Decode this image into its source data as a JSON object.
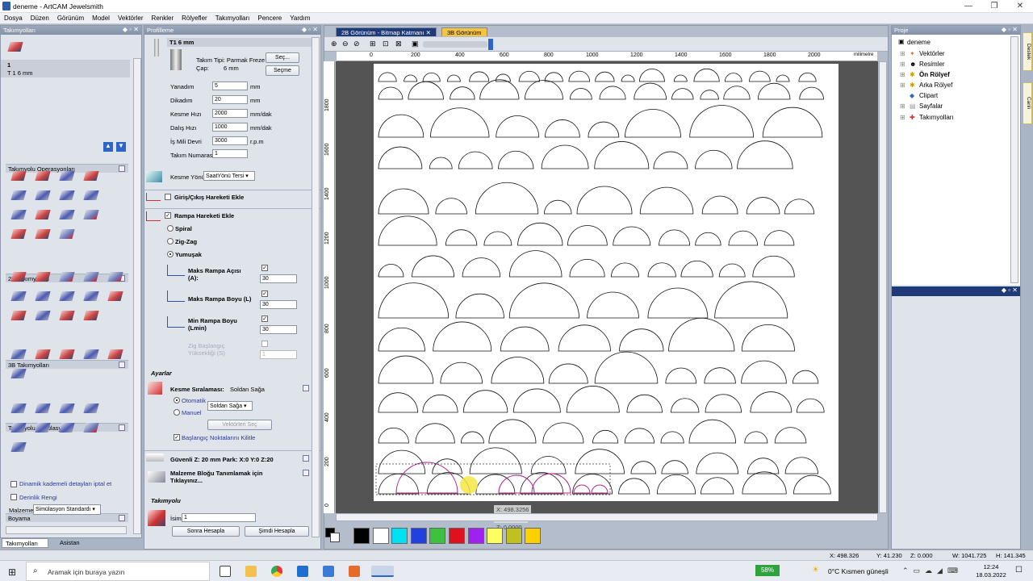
{
  "window": {
    "title": "deneme - ArtCAM Jewelsmith"
  },
  "menu": [
    "Dosya",
    "Düzen",
    "Görünüm",
    "Model",
    "Vektörler",
    "Renkler",
    "Rölyefler",
    "Takımyolları",
    "Pencere",
    "Yardım"
  ],
  "left_panel": {
    "title": "Takımyolları",
    "toolpath_number": "1",
    "toolpath_name": "T 1 6 mm",
    "sections": {
      "ops": "Takımyolu Operasyonları",
      "tp2d": "2B Takımyolları",
      "tp3d": "3B Takımyolları",
      "sim": "Takımyolu Simülasyonu",
      "paint": "Boyama"
    },
    "paint": {
      "opt1": "Dinamik kademeli detayları iptal et",
      "opt2": "Derinlik Rengi",
      "material_label": "Malzeme",
      "material_value": "Simülasyon Standardı"
    },
    "tabs": [
      "Takımyolları",
      "Asistan"
    ]
  },
  "profile_panel": {
    "title": "Profilleme",
    "tool_name": "T1 6 mm",
    "tool_type": "Takım Tipi: Parmak Freze",
    "diameter_label": "Çap:",
    "diameter_value": "6 mm",
    "btn_select": "Seç...",
    "btn_choose": "Seçme",
    "fields": [
      {
        "label": "Yanadım",
        "value": "5",
        "unit": "mm"
      },
      {
        "label": "Dikadım",
        "value": "20",
        "unit": "mm"
      },
      {
        "label": "Kesme Hızı",
        "value": "2000",
        "unit": "mm/dak"
      },
      {
        "label": "Dalış Hızı",
        "value": "1000",
        "unit": "mm/dak"
      },
      {
        "label": "İş Mili Devri",
        "value": "3000",
        "unit": "r.p.m"
      },
      {
        "label": "Takım Numarası",
        "value": "1",
        "unit": ""
      }
    ],
    "cut_dir_label": "Kesme Yönü",
    "cut_dir_value": "SaatYönü Tersi",
    "lead_in": "Giriş/Çıkış Hareketi Ekle",
    "ramp": "Rampa Hareketi Ekle",
    "ramp_opts": [
      "Spiral",
      "Zig-Zag",
      "Yumuşak"
    ],
    "max_ramp_angle": {
      "label": "Maks Rampa Açısı (A):",
      "value": "30"
    },
    "max_ramp_len": {
      "label": "Maks Rampa Boyu (L)",
      "value": "30"
    },
    "min_ramp_len": {
      "label": "Min Rampa Boyu (Lmin)",
      "value": "30"
    },
    "zig_height": {
      "label": "Zig Başlangıç Yüksekliği (S)",
      "value": "1"
    },
    "settings": "Ayarlar",
    "cut_order_label": "Kesme Sıralaması:",
    "cut_order_value": "Soldan Sağa",
    "auto": "Otomatik",
    "manual": "Manuel",
    "order_select": "Soldan Sağa",
    "btn_vectors": "Vektörleri Seç",
    "lock_start": "Başlangıç Noktalarını Kilitle",
    "safe_z": "Güvenli Z: 20 mm Park: X:0 Y:0 Z:20",
    "material_block": "Malzeme Bloğu Tanımlamak için Tıklayınız...",
    "toolpath_section": "Takımyolu",
    "name_label": "İsim",
    "name_value": "1",
    "btn_later": "Sonra Hesapla",
    "btn_now": "Şimdi Hesapla"
  },
  "document": {
    "tabs": [
      "2B Görünüm - Bitmap Katmanı",
      "3B Görünüm"
    ],
    "ruler_x": [
      "0",
      "200",
      "400",
      "600",
      "800",
      "1000",
      "1200",
      "1400",
      "1600",
      "1800",
      "2000"
    ],
    "ruler_unit": "milimetre",
    "ruler_y": [
      "1800",
      "1600",
      "1400",
      "1200",
      "1000",
      "800",
      "600",
      "400",
      "200",
      "0"
    ],
    "cursor": {
      "x": "X: 498.3256",
      "y": "Y: 41.2300",
      "z": "Z: 0.0000"
    },
    "palette": [
      "#000000",
      "#ffffff",
      "#00e0f0",
      "#2040e0",
      "#40c040",
      "#e01020",
      "#a020f0",
      "#ffff60",
      "#c0c020",
      "#ffd000"
    ]
  },
  "project": {
    "title": "Proje",
    "root": "deneme",
    "items": [
      "Vektörler",
      "Resimler",
      "Ön Rölyef",
      "Arka Rölyef",
      "Clipart",
      "Sayfalar",
      "Takımyolları"
    ],
    "side_tabs": [
      "Destek",
      "Canlı"
    ]
  },
  "status": {
    "x": "X: 498.326",
    "y": "Y: 41.230",
    "z": "Z: 0.000",
    "w": "W: 1041.725",
    "h": "H: 141.345"
  },
  "taskbar": {
    "search": "Aramak için buraya yazın",
    "battery": "58%",
    "weather": "0°C  Kısmen güneşli",
    "time": "12:24",
    "date": "18.03.2022"
  }
}
